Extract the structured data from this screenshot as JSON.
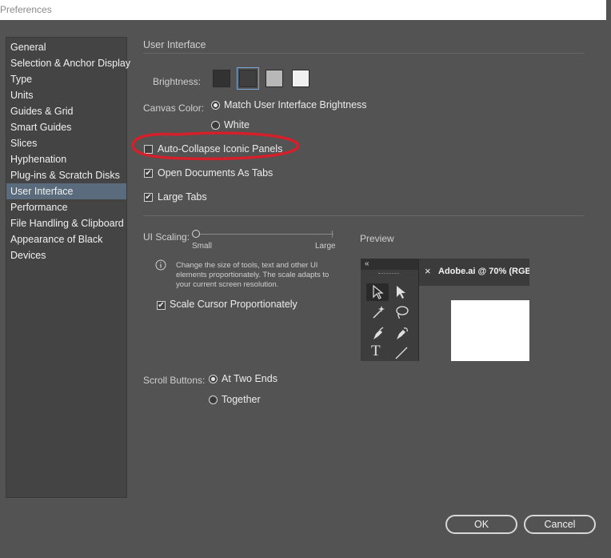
{
  "window": {
    "title": "Preferences"
  },
  "sidebar": {
    "items": [
      {
        "label": "General"
      },
      {
        "label": "Selection & Anchor Display"
      },
      {
        "label": "Type"
      },
      {
        "label": "Units"
      },
      {
        "label": "Guides & Grid"
      },
      {
        "label": "Smart Guides"
      },
      {
        "label": "Slices"
      },
      {
        "label": "Hyphenation"
      },
      {
        "label": "Plug-ins & Scratch Disks"
      },
      {
        "label": "User Interface"
      },
      {
        "label": "Performance"
      },
      {
        "label": "File Handling & Clipboard"
      },
      {
        "label": "Appearance of Black"
      },
      {
        "label": "Devices"
      }
    ],
    "selected": "User Interface"
  },
  "main": {
    "section_title": "User Interface",
    "brightness": {
      "label": "Brightness:",
      "swatch_colors": [
        "#323232",
        "#3f3f3f",
        "#b8b8b8",
        "#f0f0f0"
      ],
      "selected_index": 1
    },
    "canvas_color": {
      "label": "Canvas Color:",
      "options": [
        "Match User Interface Brightness",
        "White"
      ],
      "selected": "Match User Interface Brightness"
    },
    "auto_collapse": {
      "label": "Auto-Collapse Iconic Panels",
      "checked": false,
      "annotation_color": "#d4202a"
    },
    "open_documents_as_tabs": {
      "label": "Open Documents As Tabs",
      "checked": true
    },
    "large_tabs": {
      "label": "Large Tabs",
      "checked": true
    },
    "ui_scaling": {
      "label": "UI Scaling:",
      "min_label": "Small",
      "max_label": "Large",
      "value_fraction": 0,
      "help_icon": "info-icon",
      "help_text": "Change the size of tools, text and other UI elements proportionately. The scale adapts to your current screen resolution.",
      "scale_cursor": {
        "label": "Scale Cursor Proportionately",
        "checked": true
      }
    },
    "preview": {
      "label": "Preview",
      "collapse_glyph": "«",
      "tab_close": "×",
      "tab_title": "Adobe.ai @ 70% (RGB/",
      "tool_icons": [
        "selection-arrow-icon",
        "direct-selection-arrow-icon",
        "magic-wand-icon",
        "lasso-icon",
        "pen-icon",
        "curvature-pen-icon",
        "type-icon",
        "line-icon"
      ]
    },
    "scroll_buttons": {
      "label": "Scroll Buttons:",
      "options": [
        "At Two Ends",
        "Together"
      ],
      "selected": "At Two Ends"
    }
  },
  "footer": {
    "ok_label": "OK",
    "cancel_label": "Cancel"
  }
}
